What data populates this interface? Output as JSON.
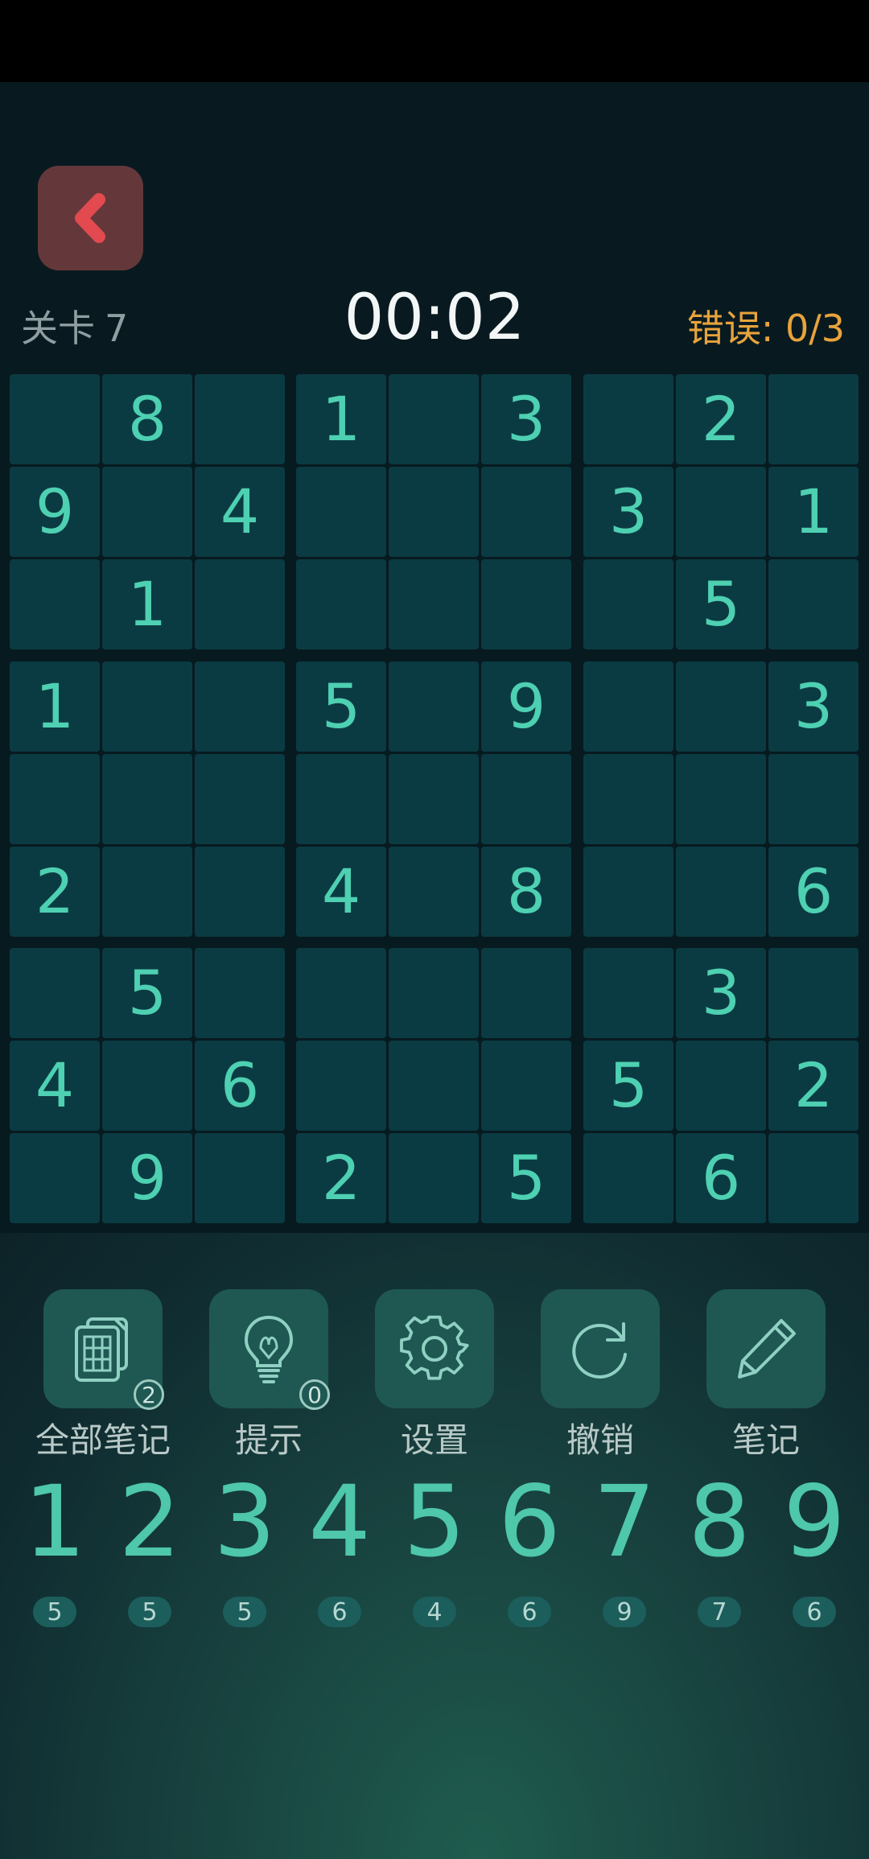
{
  "header": {
    "level_label": "关卡",
    "level_number": "7",
    "timer": "00:02",
    "errors": "错误: 0/3"
  },
  "colors": {
    "accent": "#4ed0b2",
    "error": "#e8a33c",
    "back_button": "#64383a",
    "cell": "#0b3b42"
  },
  "board": [
    [
      "",
      "8",
      "",
      "1",
      "",
      "3",
      "",
      "2",
      ""
    ],
    [
      "9",
      "",
      "4",
      "",
      "",
      "",
      "3",
      "",
      "1"
    ],
    [
      "",
      "1",
      "",
      "",
      "",
      "",
      "",
      "5",
      ""
    ],
    [
      "1",
      "",
      "",
      "5",
      "",
      "9",
      "",
      "",
      "3"
    ],
    [
      "",
      "",
      "",
      "",
      "",
      "",
      "",
      "",
      ""
    ],
    [
      "2",
      "",
      "",
      "4",
      "",
      "8",
      "",
      "",
      "6"
    ],
    [
      "",
      "5",
      "",
      "",
      "",
      "",
      "",
      "3",
      ""
    ],
    [
      "4",
      "",
      "6",
      "",
      "",
      "",
      "5",
      "",
      "2"
    ],
    [
      "",
      "9",
      "",
      "2",
      "",
      "5",
      "",
      "6",
      ""
    ]
  ],
  "tools": [
    {
      "name": "all-notes",
      "label": "全部笔记",
      "badge": "2",
      "icon": "notes-grid-icon"
    },
    {
      "name": "hint",
      "label": "提示",
      "badge": "0",
      "icon": "lightbulb-icon"
    },
    {
      "name": "settings",
      "label": "设置",
      "badge": "",
      "icon": "gear-icon"
    },
    {
      "name": "undo",
      "label": "撤销",
      "badge": "",
      "icon": "undo-icon"
    },
    {
      "name": "notes",
      "label": "笔记",
      "badge": "",
      "icon": "pencil-icon"
    }
  ],
  "numpad": [
    {
      "digit": "1",
      "remaining": "5"
    },
    {
      "digit": "2",
      "remaining": "5"
    },
    {
      "digit": "3",
      "remaining": "5"
    },
    {
      "digit": "4",
      "remaining": "6"
    },
    {
      "digit": "5",
      "remaining": "4"
    },
    {
      "digit": "6",
      "remaining": "6"
    },
    {
      "digit": "7",
      "remaining": "9"
    },
    {
      "digit": "8",
      "remaining": "7"
    },
    {
      "digit": "9",
      "remaining": "6"
    }
  ]
}
